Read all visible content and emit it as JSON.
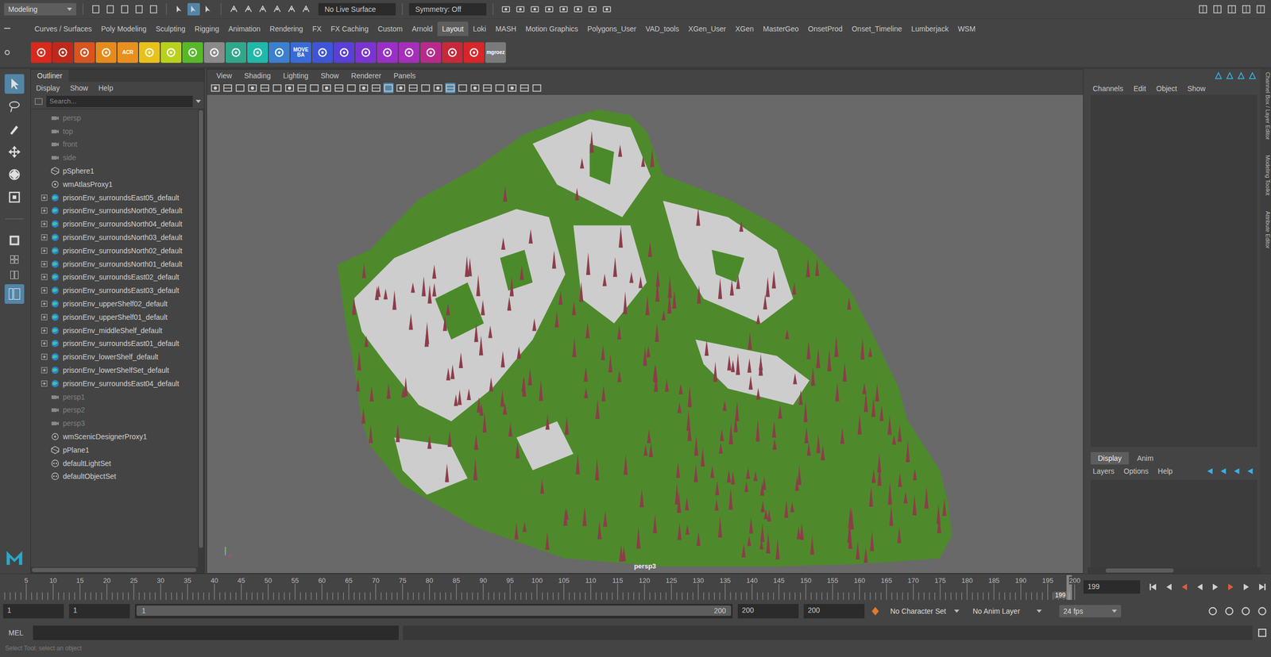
{
  "top_bar": {
    "mode": "Modeling",
    "live_surface": "No Live Surface",
    "symmetry": "Symmetry: Off"
  },
  "shelf_tabs": [
    {
      "label": "Curves / Surfaces",
      "selected": false
    },
    {
      "label": "Poly Modeling",
      "selected": false
    },
    {
      "label": "Sculpting",
      "selected": false
    },
    {
      "label": "Rigging",
      "selected": false
    },
    {
      "label": "Animation",
      "selected": false
    },
    {
      "label": "Rendering",
      "selected": false
    },
    {
      "label": "FX",
      "selected": false
    },
    {
      "label": "FX Caching",
      "selected": false
    },
    {
      "label": "Custom",
      "selected": false
    },
    {
      "label": "Arnold",
      "selected": false
    },
    {
      "label": "Layout",
      "selected": true
    },
    {
      "label": "Loki",
      "selected": false
    },
    {
      "label": "MASH",
      "selected": false
    },
    {
      "label": "Motion Graphics",
      "selected": false
    },
    {
      "label": "Polygons_User",
      "selected": false
    },
    {
      "label": "VAD_tools",
      "selected": false
    },
    {
      "label": "XGen_User",
      "selected": false
    },
    {
      "label": "XGen",
      "selected": false
    },
    {
      "label": "MasterGeo",
      "selected": false
    },
    {
      "label": "OnsetProd",
      "selected": false
    },
    {
      "label": "Onset_Timeline",
      "selected": false
    },
    {
      "label": "Lumberjack",
      "selected": false
    },
    {
      "label": "WSM",
      "selected": false
    }
  ],
  "shelf_icons": [
    {
      "color": "#d8291c",
      "label": ""
    },
    {
      "color": "#c0281c",
      "label": ""
    },
    {
      "color": "#d9541e",
      "label": ""
    },
    {
      "color": "#e88a1a",
      "label": ""
    },
    {
      "color": "#e8901e",
      "label": "ACR"
    },
    {
      "color": "#e8c21a",
      "label": ""
    },
    {
      "color": "#b8d21c",
      "label": ""
    },
    {
      "color": "#58b82a",
      "label": ""
    },
    {
      "color": "#8a8a8a",
      "label": ""
    },
    {
      "color": "#2fa88a",
      "label": ""
    },
    {
      "color": "#20b8a8",
      "label": ""
    },
    {
      "color": "#3a7fd0",
      "label": ""
    },
    {
      "color": "#3a6ad8",
      "label": "MOVE BA"
    },
    {
      "color": "#3f55d8",
      "label": ""
    },
    {
      "color": "#5a3fd8",
      "label": ""
    },
    {
      "color": "#7a35d0",
      "label": ""
    },
    {
      "color": "#9a2fc8",
      "label": ""
    },
    {
      "color": "#a52fb8",
      "label": ""
    },
    {
      "color": "#b82a8a",
      "label": ""
    },
    {
      "color": "#c8283a",
      "label": ""
    },
    {
      "color": "#d8262a",
      "label": ""
    },
    {
      "color": "#7a7a7a",
      "label": "mgroez"
    }
  ],
  "outliner": {
    "title": "Outliner",
    "menu": [
      "Display",
      "Show",
      "Help"
    ],
    "search_placeholder": "Search...",
    "items": [
      {
        "name": "persp",
        "kind": "camera",
        "dim": true,
        "expandable": false
      },
      {
        "name": "top",
        "kind": "camera",
        "dim": true,
        "expandable": false
      },
      {
        "name": "front",
        "kind": "camera",
        "dim": true,
        "expandable": false
      },
      {
        "name": "side",
        "kind": "camera",
        "dim": true,
        "expandable": false
      },
      {
        "name": "pSphere1",
        "kind": "mesh",
        "dim": false,
        "expandable": false
      },
      {
        "name": "wmAtlasProxy1",
        "kind": "proxy",
        "dim": false,
        "expandable": false
      },
      {
        "name": "prisonEnv_surroundsEast05_default",
        "kind": "asset",
        "dim": false,
        "expandable": true
      },
      {
        "name": "prisonEnv_surroundsNorth05_default",
        "kind": "asset",
        "dim": false,
        "expandable": true
      },
      {
        "name": "prisonEnv_surroundsNorth04_default",
        "kind": "asset",
        "dim": false,
        "expandable": true
      },
      {
        "name": "prisonEnv_surroundsNorth03_default",
        "kind": "asset",
        "dim": false,
        "expandable": true
      },
      {
        "name": "prisonEnv_surroundsNorth02_default",
        "kind": "asset",
        "dim": false,
        "expandable": true
      },
      {
        "name": "prisonEnv_surroundsNorth01_default",
        "kind": "asset",
        "dim": false,
        "expandable": true
      },
      {
        "name": "prisonEnv_surroundsEast02_default",
        "kind": "asset",
        "dim": false,
        "expandable": true
      },
      {
        "name": "prisonEnv_surroundsEast03_default",
        "kind": "asset",
        "dim": false,
        "expandable": true
      },
      {
        "name": "prisonEnv_upperShelf02_default",
        "kind": "asset",
        "dim": false,
        "expandable": true
      },
      {
        "name": "prisonEnv_upperShelf01_default",
        "kind": "asset",
        "dim": false,
        "expandable": true
      },
      {
        "name": "prisonEnv_middleShelf_default",
        "kind": "asset",
        "dim": false,
        "expandable": true
      },
      {
        "name": "prisonEnv_surroundsEast01_default",
        "kind": "asset",
        "dim": false,
        "expandable": true
      },
      {
        "name": "prisonEnv_lowerShelf_default",
        "kind": "asset",
        "dim": false,
        "expandable": true
      },
      {
        "name": "prisonEnv_lowerShelfSet_default",
        "kind": "asset",
        "dim": false,
        "expandable": true
      },
      {
        "name": "prisonEnv_surroundsEast04_default",
        "kind": "asset",
        "dim": false,
        "expandable": true
      },
      {
        "name": "persp1",
        "kind": "camera",
        "dim": true,
        "expandable": false
      },
      {
        "name": "persp2",
        "kind": "camera",
        "dim": true,
        "expandable": false
      },
      {
        "name": "persp3",
        "kind": "camera",
        "dim": true,
        "expandable": false
      },
      {
        "name": "wmScenicDesignerProxy1",
        "kind": "proxy",
        "dim": false,
        "expandable": false
      },
      {
        "name": "pPlane1",
        "kind": "mesh",
        "dim": false,
        "expandable": false
      },
      {
        "name": "defaultLightSet",
        "kind": "set",
        "dim": false,
        "expandable": false
      },
      {
        "name": "defaultObjectSet",
        "kind": "set",
        "dim": false,
        "expandable": false
      }
    ]
  },
  "viewport": {
    "menu": [
      "View",
      "Shading",
      "Lighting",
      "Show",
      "Renderer",
      "Panels"
    ],
    "camera_label": "persp3"
  },
  "channel_box": {
    "menu": [
      "Channels",
      "Edit",
      "Object",
      "Show"
    ]
  },
  "layer_editor": {
    "tabs": [
      {
        "label": "Display",
        "selected": true
      },
      {
        "label": "Anim",
        "selected": false
      }
    ],
    "menu": [
      "Layers",
      "Options",
      "Help"
    ]
  },
  "side_tabs": [
    "Channel Box / Layer Editor",
    "Modeling Toolkit",
    "Attribute Editor"
  ],
  "timeline": {
    "ticks": [
      "5",
      "10",
      "15",
      "20",
      "25",
      "30",
      "35",
      "40",
      "45",
      "50",
      "55",
      "60",
      "65",
      "70",
      "75",
      "80",
      "85",
      "90",
      "95",
      "100",
      "105",
      "110",
      "115",
      "120",
      "125",
      "130",
      "135",
      "140",
      "145",
      "150",
      "155",
      "160",
      "165",
      "170",
      "175",
      "180",
      "185",
      "190",
      "195"
    ],
    "end_label": "200",
    "current_frame": "199"
  },
  "range": {
    "start": "1",
    "playback_start": "1",
    "slider_start": "1",
    "slider_end": "200",
    "playback_end": "200",
    "end": "200",
    "character_set": "No Character Set",
    "anim_layer": "No Anim Layer",
    "fps": "24 fps"
  },
  "command_line": {
    "language": "MEL"
  },
  "help_line": "Select Tool: select an object"
}
